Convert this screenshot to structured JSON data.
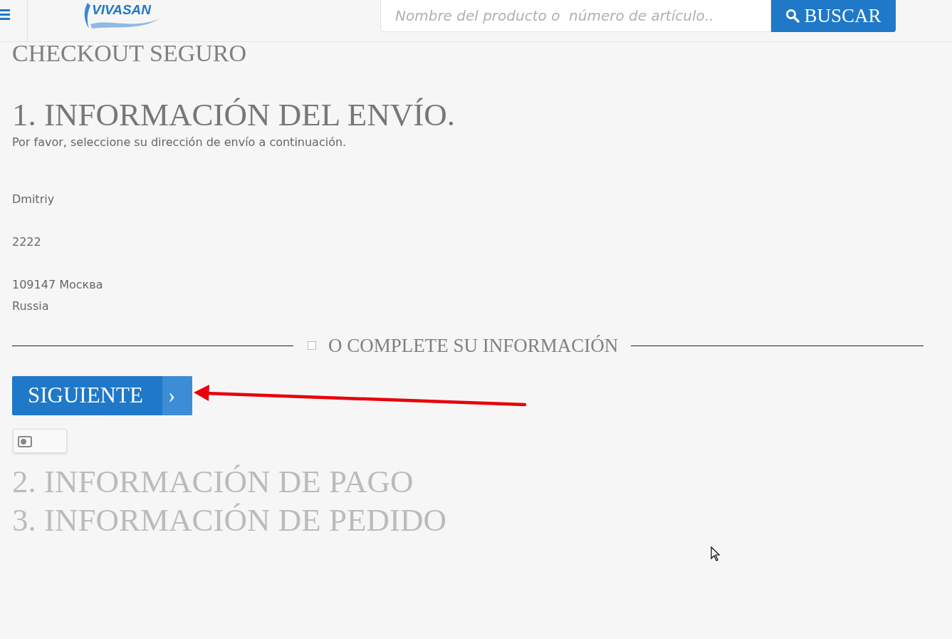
{
  "header": {
    "logo": "VIVASAN",
    "search": {
      "placeholder": "Nombre del producto o  número de artículo.."
    },
    "search_button": "BUSCAR"
  },
  "page_title": "CHECKOUT SEGURO",
  "steps": [
    {
      "title": "1. INFORMACIÓN DEL ENVÍO.",
      "active": true,
      "description": "Por favor, seleccione su dirección de envío a continuación.",
      "address": [
        [
          "Dmitriy"
        ],
        [
          "2222"
        ],
        [
          "109147 Москва",
          "Russia"
        ]
      ],
      "divider": {
        "label": "O COMPLETE SU INFORMACIÓN",
        "checked": false
      },
      "next_button": "SIGUIENTE",
      "next_icon": "›"
    },
    {
      "title": "2. INFORMACIÓN DE PAGO",
      "active": false
    },
    {
      "title": "3. INFORMACIÓN DE PEDIDO",
      "active": false
    }
  ]
}
